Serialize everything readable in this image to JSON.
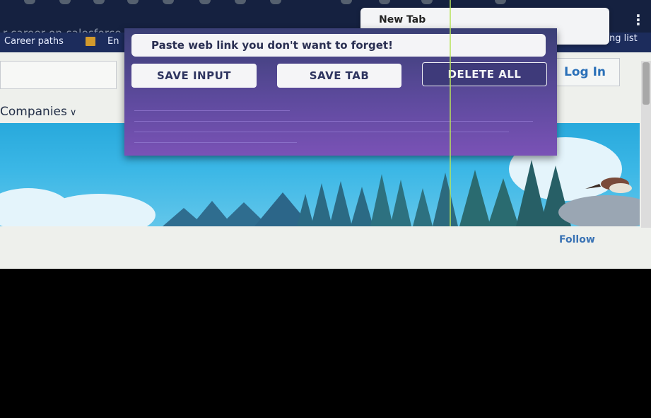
{
  "browser": {
    "url_text": "r-career-on-salesforce",
    "menu_glyph": "⋮"
  },
  "bookmarks": {
    "items": [
      "Career paths",
      "En"
    ],
    "overflow_label": "ng list"
  },
  "new_tab_popup": {
    "label": "New Tab"
  },
  "extension": {
    "input_placeholder": "Paste web link you don't want to forget!",
    "buttons": {
      "save_input": "SAVE INPUT",
      "save_tab": "SAVE TAB",
      "delete_all": "DELETE ALL"
    }
  },
  "page": {
    "login_label": "Log In",
    "companies_label": "Companies",
    "follow_label": "Follow"
  },
  "colors": {
    "popup_gradient_top": "#3a3f75",
    "popup_gradient_bottom": "#7a52b6",
    "banner_sky": "#28a9dc",
    "link_blue": "#2a70b8"
  }
}
